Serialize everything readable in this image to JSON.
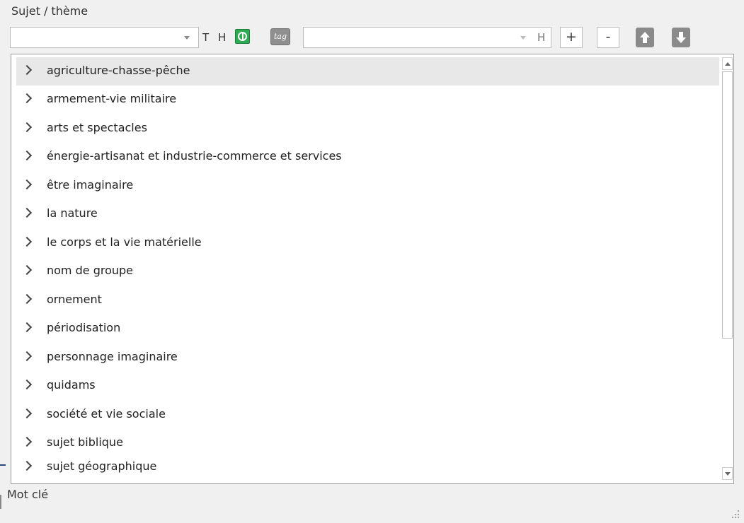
{
  "labels": {
    "subject_theme": "Sujet / thème",
    "keyword": "Mot clé"
  },
  "toolbar": {
    "combo_value": "",
    "t_label": "T",
    "h_label": "H",
    "second_h_label": "H",
    "second_combo_value": "",
    "add_label": "+",
    "remove_label": "-",
    "icons": [
      "globe-icon",
      "tag-icon",
      "move-up-icon",
      "move-down-icon"
    ]
  },
  "tree": {
    "items": [
      {
        "label": "agriculture-chasse-pêche",
        "selected": true
      },
      {
        "label": "armement-vie militaire"
      },
      {
        "label": "arts et spectacles"
      },
      {
        "label": "énergie-artisanat et industrie-commerce et services"
      },
      {
        "label": "être imaginaire"
      },
      {
        "label": "la nature"
      },
      {
        "label": "le corps et la vie matérielle"
      },
      {
        "label": "nom de groupe"
      },
      {
        "label": "ornement"
      },
      {
        "label": "périodisation"
      },
      {
        "label": "personnage imaginaire"
      },
      {
        "label": "quidams"
      },
      {
        "label": "société et vie sociale"
      },
      {
        "label": "sujet biblique"
      },
      {
        "label": "sujet géographique"
      }
    ]
  },
  "colors": {
    "selected_row": "#e8e8e8",
    "globe_icon": "#2eaa52",
    "arrow_button": "#8a8a8a"
  }
}
